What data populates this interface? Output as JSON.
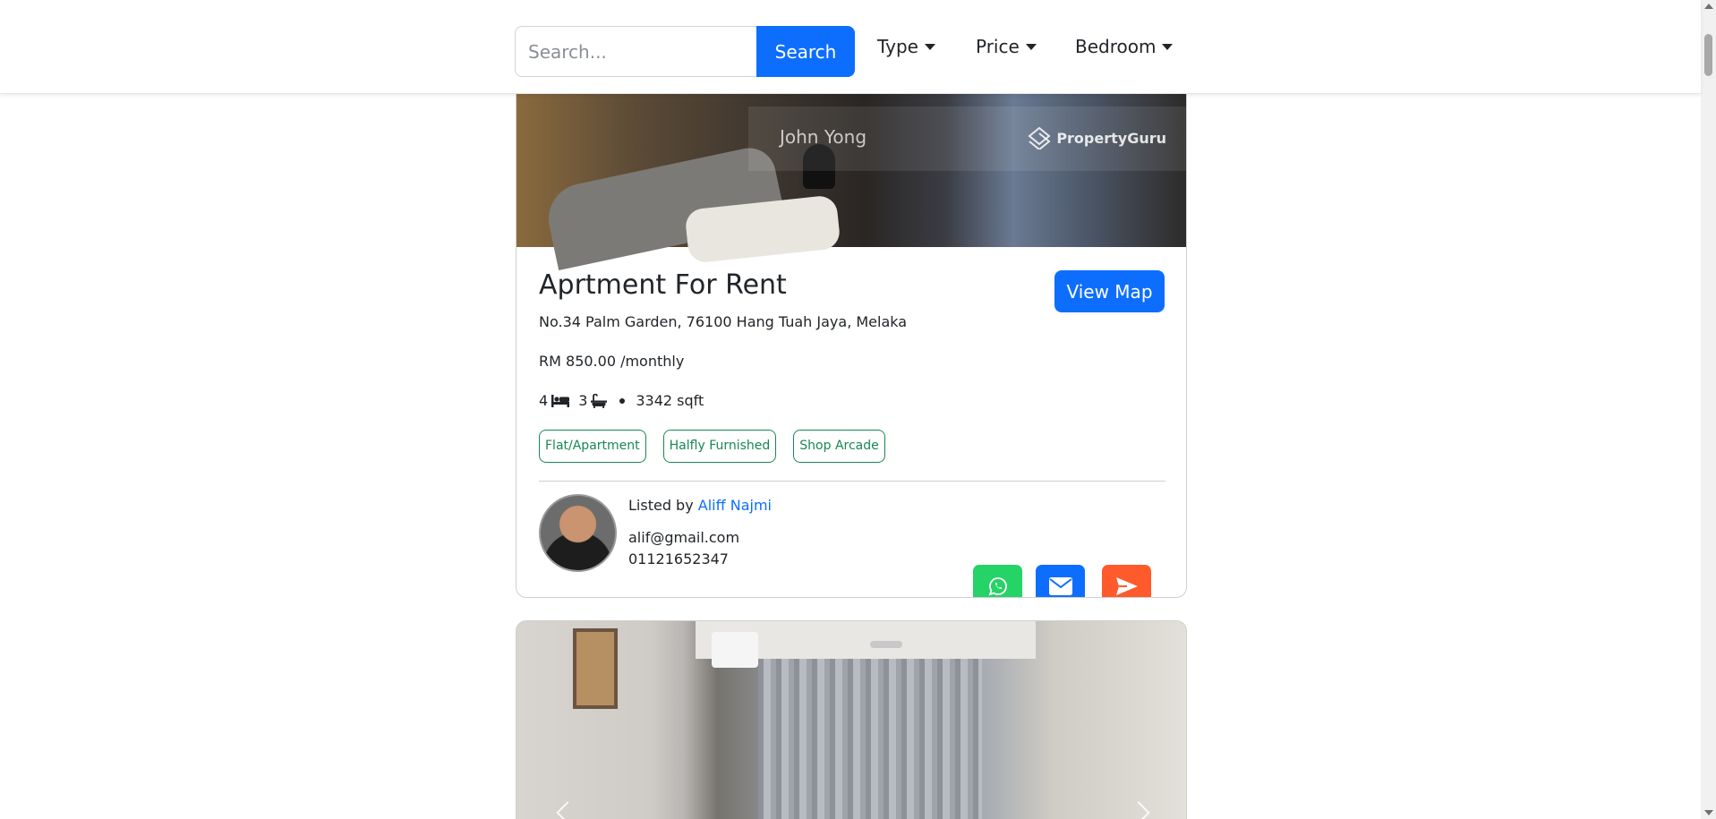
{
  "navbar": {
    "search_placeholder": "Search...",
    "search_button": "Search",
    "filters": [
      {
        "label": "Type"
      },
      {
        "label": "Price"
      },
      {
        "label": "Bedroom"
      }
    ]
  },
  "listing": {
    "photo": {
      "watermark_name": "John Yong",
      "watermark_logo": "PropertyGuru"
    },
    "title": "Aprtment For Rent",
    "view_map_button": "View Map",
    "address": "No.34 Palm Garden, 76100 Hang Tuah Jaya, Melaka",
    "price": "RM 850.00 /monthly",
    "bedrooms": "4",
    "bathrooms": "3",
    "area": "3342 sqft",
    "tags": [
      "Flat/Apartment",
      "Halfly Furnished",
      "Shop Arcade"
    ],
    "agent": {
      "listed_by_prefix": "Listed by",
      "name": "Aliff Najmi",
      "email": "alif@gmail.com",
      "phone": "01121652347"
    },
    "contact_icons": [
      "whatsapp-icon",
      "envelope-icon",
      "send-icon"
    ]
  },
  "colors": {
    "primary": "#0d6efd",
    "tag_green": "#198754",
    "whatsapp": "#25d366",
    "send": "#ff5a2c"
  }
}
